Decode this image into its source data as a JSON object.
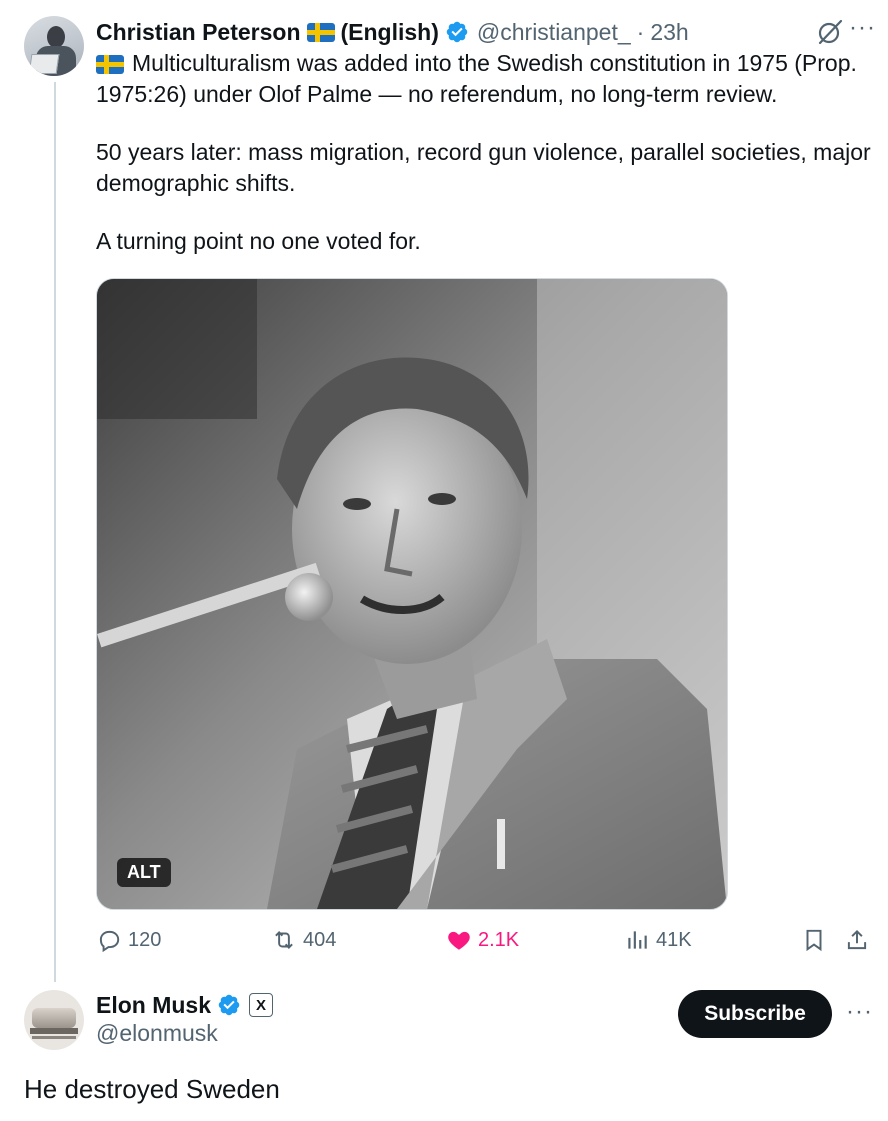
{
  "tweet": {
    "author": {
      "name": "Christian Peterson",
      "name_suffix": "(English)",
      "handle": "@christianpet_",
      "time": "23h"
    },
    "text_lines": [
      "Multiculturalism was added into the Swedish constitution in 1975 (Prop. 1975:26) under Olof Palme — no referendum, no long-term review.",
      "50 years later: mass migration, record gun violence, parallel societies, major demographic shifts.",
      "A turning point no one voted for."
    ],
    "media": {
      "alt_badge": "ALT"
    },
    "stats": {
      "replies": "120",
      "reposts": "404",
      "likes": "2.1K",
      "views": "41K"
    }
  },
  "reply": {
    "author": {
      "name": "Elon Musk",
      "handle": "@elonmusk",
      "badge": "X"
    },
    "subscribe_label": "Subscribe",
    "text": "He destroyed Sweden"
  },
  "colors": {
    "verified_blue": "#1d9bf0",
    "like_pink": "#f91880",
    "secondary_text": "#536471",
    "divider": "#cfd9de"
  }
}
